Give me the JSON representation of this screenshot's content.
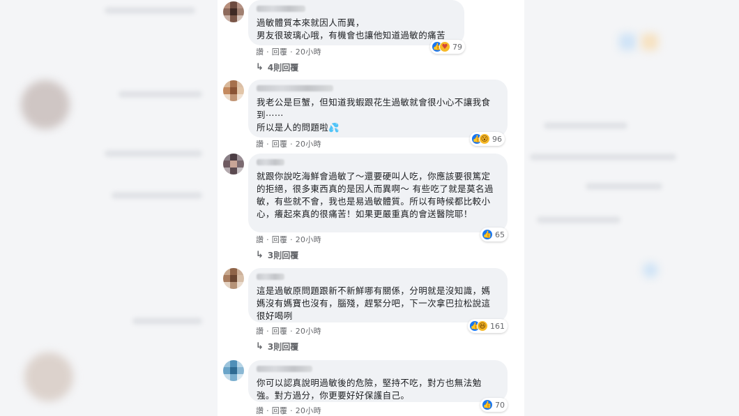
{
  "comments": [
    {
      "text": "過敏體質本來就因人而異，\n男友很玻璃心哦，有機會也讓他知道過敏的痛苦",
      "reaction_count": "79",
      "reactions": [
        "like",
        "care"
      ],
      "actions": {
        "like": "讚",
        "reply": "回覆",
        "time": "20小時"
      },
      "replies_label": "4則回覆"
    },
    {
      "text": "我老公是巨蟹，但知道我蝦跟花生過敏就會很小心不讓我食到⋯⋯\n所以是人的問題啦💦",
      "reaction_count": "96",
      "reactions": [
        "like",
        "wow"
      ],
      "actions": {
        "like": "讚",
        "reply": "回覆",
        "time": "20小時"
      }
    },
    {
      "text": "就跟你說吃海鮮會過敏了～還要硬叫人吃，你應該要很篤定的拒絕，很多東西真的是因人而異啊～ 有些吃了就是莫名過敏，有些就不會，我也是易過敏體質。所以有時候都比較小心，癢起來真的很痛苦！如果更嚴重真的會送醫院耶！",
      "reaction_count": "65",
      "reactions": [
        "like"
      ],
      "actions": {
        "like": "讚",
        "reply": "回覆",
        "time": "20小時"
      },
      "replies_label": "3則回覆"
    },
    {
      "text": "這是過敏原問題跟新不新鮮哪有關係，分明就是沒知識，媽媽沒有媽寶也沒有，腦殘，趕緊分吧，下一次拿巴拉松說這很好喝咧",
      "reaction_count": "161",
      "reactions": [
        "like",
        "haha"
      ],
      "actions": {
        "like": "讚",
        "reply": "回覆",
        "time": "20小時"
      },
      "replies_label": "3則回覆"
    },
    {
      "text": "你可以認真說明過敏後的危險，堅持不吃，對方也無法勉強。對方過分，你更要好好保護自己。",
      "reaction_count": "70",
      "reactions": [
        "like"
      ],
      "actions": {
        "like": "讚",
        "reply": "回覆",
        "time": "20小時"
      }
    }
  ],
  "icons": {
    "like": "thumbs-up-icon",
    "haha": "laugh-icon",
    "wow": "wow-icon",
    "care": "care-icon",
    "reply_arrow": "reply-arrow-icon"
  },
  "colors": {
    "bubble": "#f0f2f5",
    "like_blue": "#1877f2",
    "meta_gray": "#65676b"
  }
}
